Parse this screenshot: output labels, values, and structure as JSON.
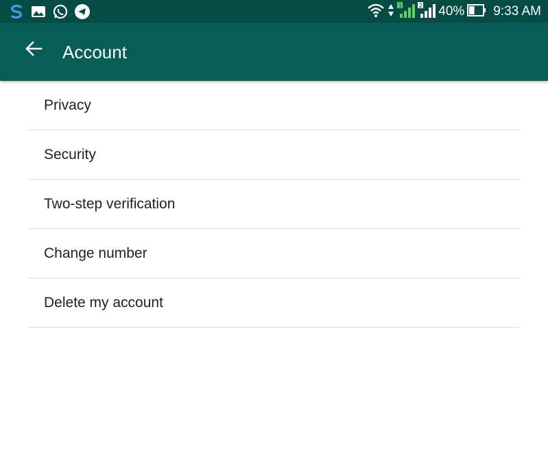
{
  "status_bar": {
    "icons_left": [
      "s-app-icon",
      "gallery-icon",
      "whatsapp-icon",
      "telegram-icon"
    ],
    "icons_right": [
      "wifi-icon",
      "data-arrows-icon",
      "signal-sim1-icon",
      "signal-sim2-icon"
    ],
    "battery_percent": "40%",
    "battery_level": 0.4,
    "time": "9:33 AM"
  },
  "app_bar": {
    "title": "Account",
    "color": "#075e54",
    "status_color": "#054d44"
  },
  "menu": {
    "items": [
      {
        "label": "Privacy"
      },
      {
        "label": "Security"
      },
      {
        "label": "Two-step verification"
      },
      {
        "label": "Change number"
      },
      {
        "label": "Delete my account"
      }
    ]
  }
}
